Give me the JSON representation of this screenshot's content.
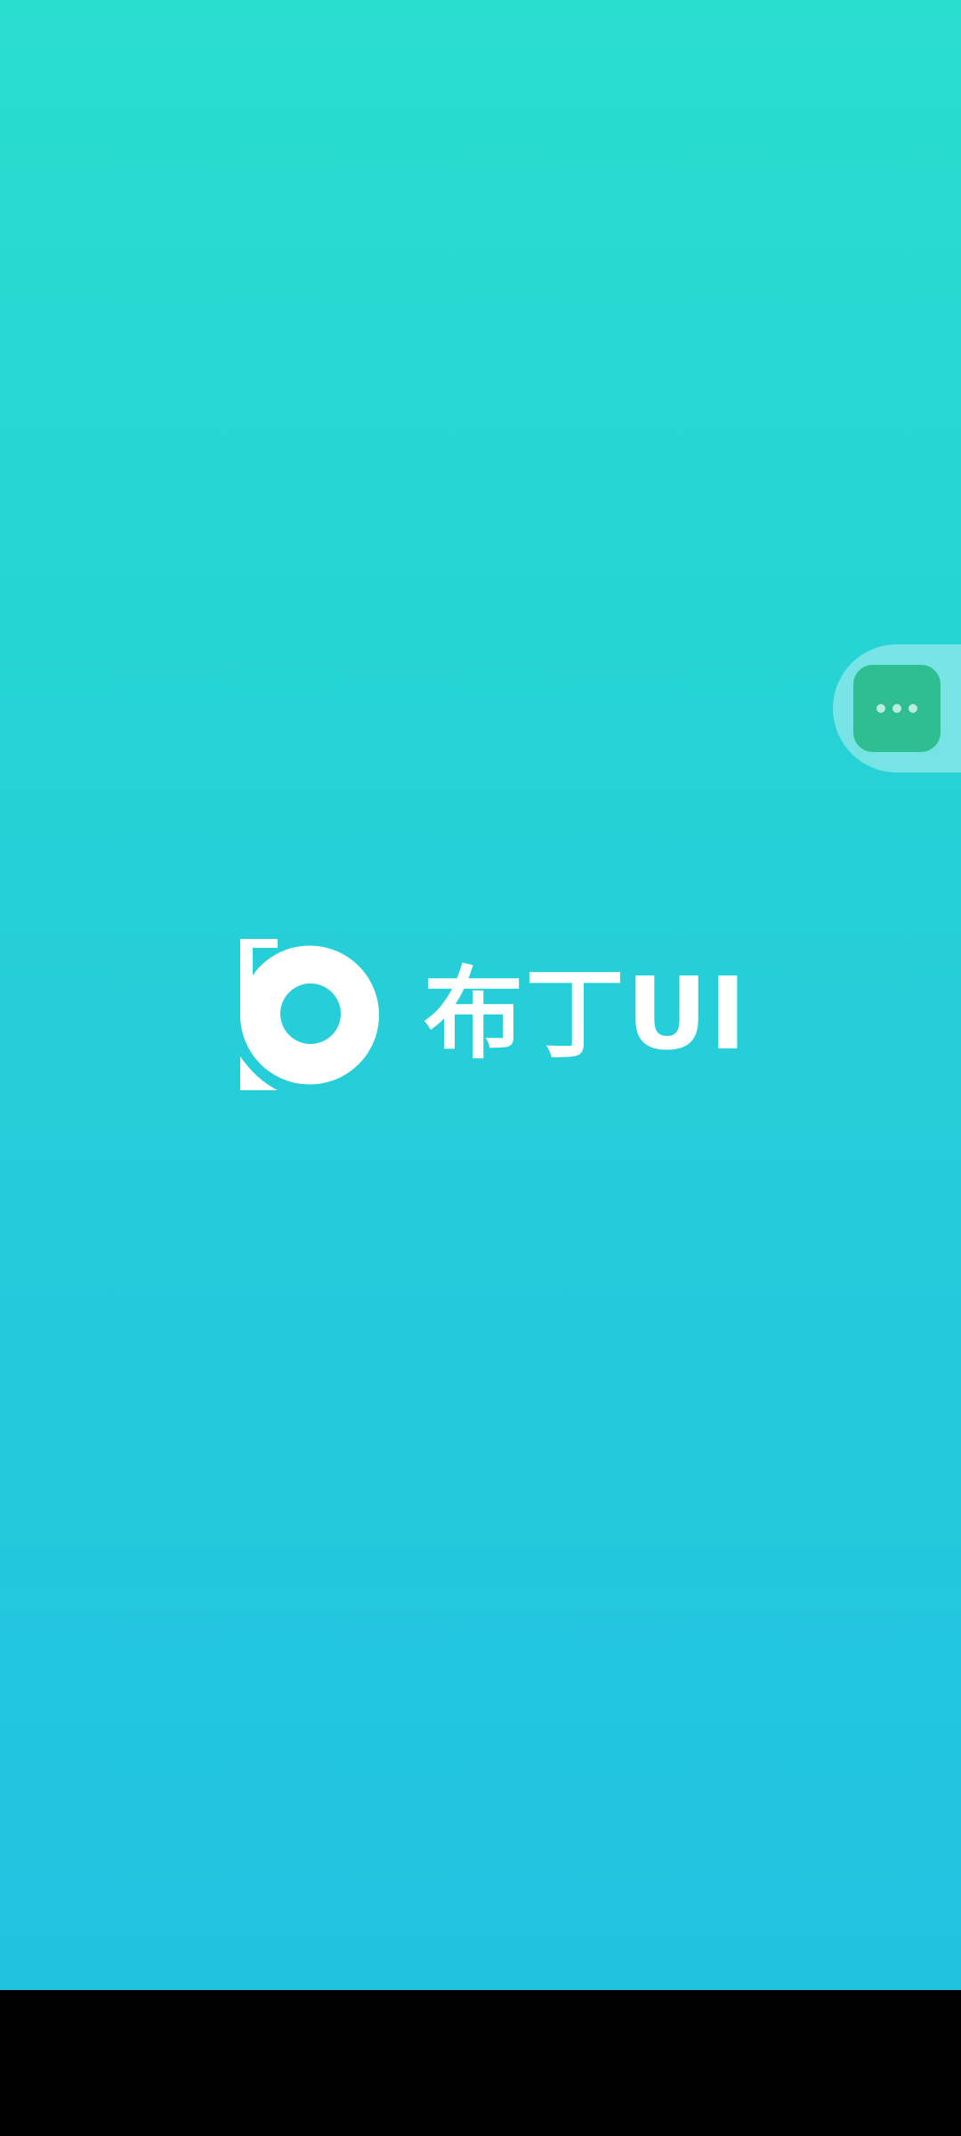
{
  "brand": {
    "name": "布丁UI",
    "logo_icon": "pudding-b-logo-icon",
    "text_color": "#ffffff"
  },
  "floating_menu": {
    "icon": "more-horizontal-icon",
    "button_color": "#2fbe92"
  },
  "colors": {
    "gradient_top": "#29ddcf",
    "gradient_bottom": "#21c2e1",
    "bottom_bar": "#000000"
  }
}
